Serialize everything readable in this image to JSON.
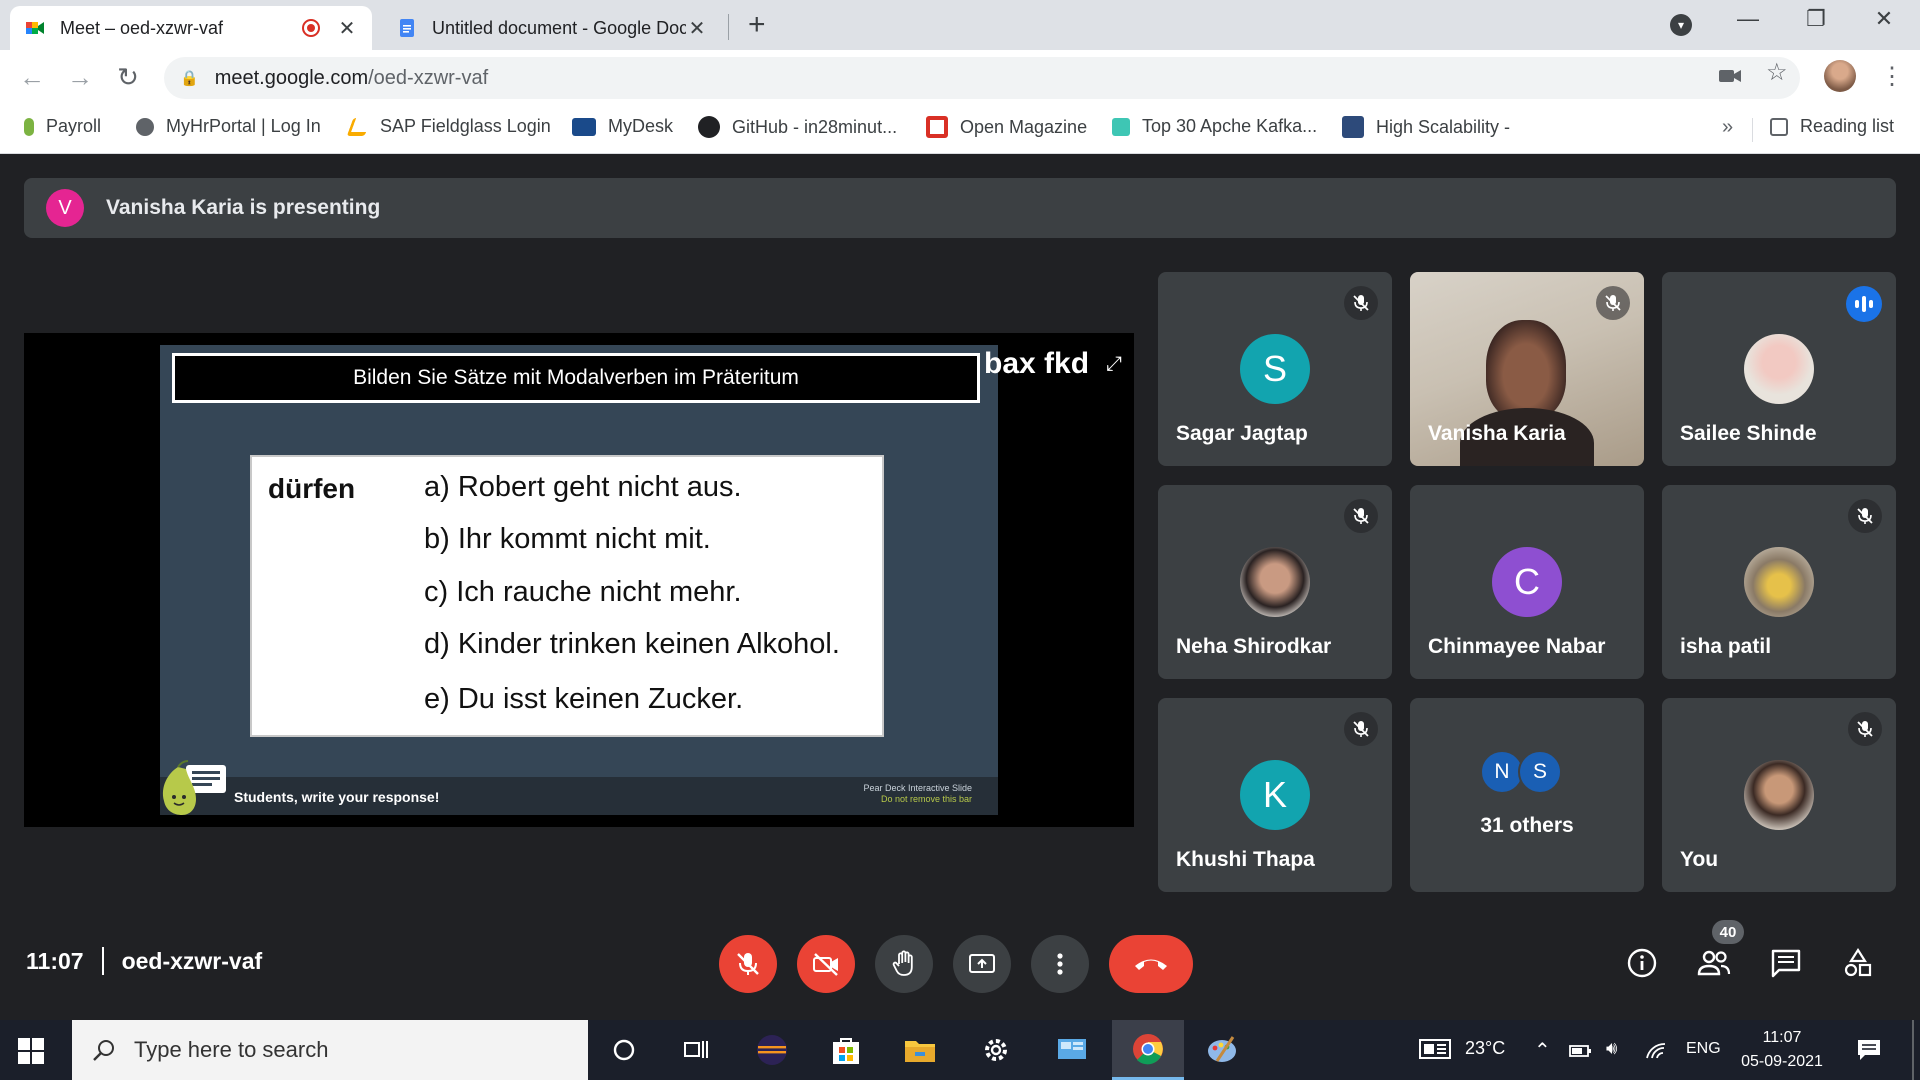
{
  "browser": {
    "tabs": [
      {
        "title": "Meet – oed-xzwr-vaf",
        "active": true,
        "recording": true
      },
      {
        "title": "Untitled document - Google Doc",
        "active": false
      }
    ],
    "url_host": "meet.google.com",
    "url_path": "/oed-xzwr-vaf",
    "bookmarks": [
      {
        "label": "Payroll",
        "color": "#7cb342"
      },
      {
        "label": "MyHrPortal | Log In",
        "color": "#5f6368"
      },
      {
        "label": "SAP Fieldglass Login",
        "color": "#f9ab00"
      },
      {
        "label": "MyDesk",
        "color": "#1a4a8a"
      },
      {
        "label": "GitHub - in28minut...",
        "color": "#202124"
      },
      {
        "label": "Open Magazine",
        "color": "#d93025"
      },
      {
        "label": "Top 30 Apche Kafka...",
        "color": "#3ec6b4"
      },
      {
        "label": "High Scalability -",
        "color": "#2d4a7a"
      }
    ],
    "reading_list": "Reading list"
  },
  "meet": {
    "presenter_initial": "V",
    "presenting_text": "Vanisha Karia is presenting",
    "slide": {
      "title": "Bilden Sie Sätze mit Modalverben im Präteritum",
      "verb": "dürfen",
      "lines": [
        "a) Robert geht nicht aus.",
        "b) Ihr kommt nicht mit.",
        "c) Ich rauche nicht mehr.",
        "d) Kinder trinken keinen Alkohol.",
        "e) Du isst keinen Zucker."
      ],
      "footer_left": "Students, write your response!",
      "footer_right_1": "Pear Deck Interactive Slide",
      "footer_right_2": "Do not remove this bar"
    },
    "stage_label": "bax fkd",
    "participants": [
      {
        "name": "Sagar Jagtap",
        "initial": "S",
        "color": "#12a4af",
        "muted": true
      },
      {
        "name": "Vanisha Karia",
        "video": true,
        "muted": true
      },
      {
        "name": "Sailee Shinde",
        "photo": true,
        "speaking": true
      },
      {
        "name": "Neha Shirodkar",
        "photo": true,
        "muted": true
      },
      {
        "name": "Chinmayee Nabar",
        "initial": "C",
        "color": "#8e4fd1",
        "muted": false
      },
      {
        "name": "isha patil",
        "photo": true,
        "muted": true
      },
      {
        "name": "Khushi Thapa",
        "initial": "K",
        "color": "#12a4af",
        "muted": true
      },
      {
        "others_initials": [
          "N",
          "S"
        ],
        "others_label": "31 others"
      },
      {
        "name": "You",
        "photo": true,
        "muted": true
      }
    ],
    "time": "11:07",
    "meeting_code": "oed-xzwr-vaf",
    "people_count": "40"
  },
  "taskbar": {
    "search_placeholder": "Type here to search",
    "temperature": "23°C",
    "language": "ENG",
    "time": "11:07",
    "date": "05-09-2021"
  }
}
